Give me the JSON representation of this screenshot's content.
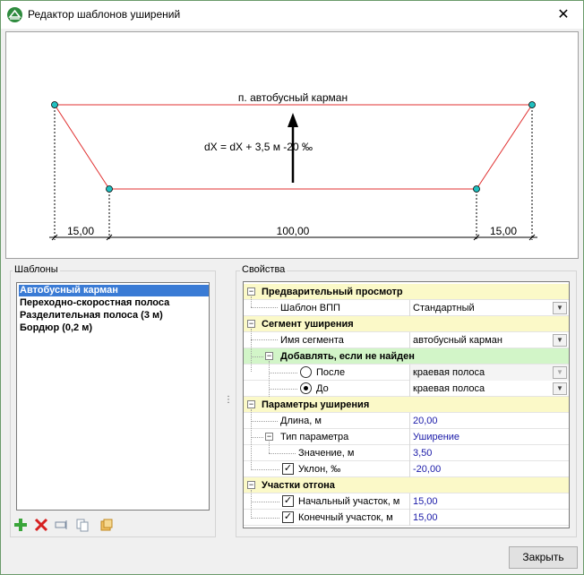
{
  "window": {
    "title": "Редактор шаблонов уширений",
    "close_glyph": "✕"
  },
  "preview": {
    "caption": "п. автобусный карман",
    "formula": "dX = dX + 3,5 м -20 ‰",
    "dim_left": "15,00",
    "dim_middle": "100,00",
    "dim_right": "15,00",
    "line_color": "#e03030",
    "node_color": "#20c0c0"
  },
  "templates": {
    "group_label": "Шаблоны",
    "items": [
      "Автобусный карман",
      "Переходно-скоростная полоса",
      "Разделительная полоса (3 м)",
      "Бордюр (0,2 м)"
    ],
    "selected_index": 0,
    "toolbar": {
      "add_icon": "plus-icon",
      "delete_icon": "delete-icon",
      "rename_icon": "rename-icon",
      "copy_icon": "copy-icon",
      "import_icon": "import-icon"
    }
  },
  "properties": {
    "group_label": "Свойства",
    "preview_cat": "Предварительный просмотр",
    "runway_template_label": "Шаблон ВПП",
    "runway_template_value": "Стандартный",
    "segment_cat": "Сегмент уширения",
    "segment_name_label": "Имя сегмента",
    "segment_name_value": "автобусный карман",
    "add_if_missing_cat": "Добавлять, если не найден",
    "after_label": "После",
    "after_value": "краевая полоса",
    "before_label": "До",
    "before_value": "краевая полоса",
    "params_cat": "Параметры уширения",
    "length_label": "Длина, м",
    "length_value": "20,00",
    "param_type_label": "Тип параметра",
    "param_type_value": "Уширение",
    "value_label": "Значение, м",
    "value_value": "3,50",
    "slope_label": "Уклон, ‰",
    "slope_value": "-20,00",
    "taper_cat": "Участки отгона",
    "start_taper_label": "Начальный участок, м",
    "start_taper_value": "15,00",
    "end_taper_label": "Конечный участок, м",
    "end_taper_value": "15,00"
  },
  "footer": {
    "close_label": "Закрыть"
  }
}
